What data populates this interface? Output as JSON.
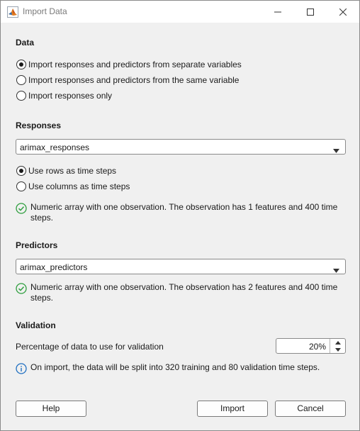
{
  "window": {
    "title": "Import Data"
  },
  "data_section": {
    "title": "Data",
    "options": [
      {
        "label": "Import responses and predictors from separate variables",
        "selected": true
      },
      {
        "label": "Import responses and predictors from the same variable",
        "selected": false
      },
      {
        "label": "Import responses only",
        "selected": false
      }
    ]
  },
  "responses": {
    "title": "Responses",
    "dropdown_value": "arimax_responses",
    "orientation": [
      {
        "label": "Use rows as time steps",
        "selected": true
      },
      {
        "label": "Use columns as time steps",
        "selected": false
      }
    ],
    "status_line1": "Numeric array with one observation. The observation has 1 features and 400 time",
    "status_line2": "steps."
  },
  "predictors": {
    "title": "Predictors",
    "dropdown_value": "arimax_predictors",
    "status_line1": "Numeric array with one observation. The observation has 2 features and 400 time",
    "status_line2": "steps."
  },
  "validation": {
    "title": "Validation",
    "label": "Percentage of data to use for validation",
    "value": "20%",
    "info": "On import, the data will be split into 320 training and 80 validation time steps."
  },
  "buttons": {
    "help": "Help",
    "import": "Import",
    "cancel": "Cancel"
  },
  "colors": {
    "success": "#2e9e3e",
    "info": "#1f6fc1",
    "background": "#f0f0f0"
  },
  "icons": {
    "app": "matlab-logo-icon",
    "minimize": "minimize-icon",
    "maximize": "maximize-icon",
    "close": "close-icon",
    "success": "check-circle-icon",
    "info": "info-icon",
    "dropdown": "chevron-down-icon"
  }
}
